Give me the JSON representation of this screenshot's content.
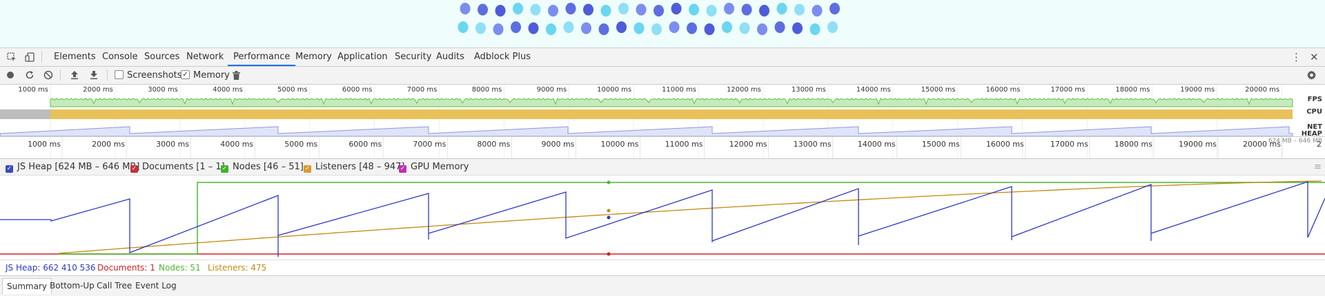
{
  "tabs": [
    "Elements",
    "Console",
    "Sources",
    "Network",
    "Performance",
    "Memory",
    "Application",
    "Security",
    "Audits",
    "Adblock Plus"
  ],
  "active_tab": "Performance",
  "toolbar": {
    "screenshots_label": "Screenshots",
    "screenshots_checked": false,
    "memory_label": "Memory",
    "memory_checked": true
  },
  "overview": {
    "ticks": [
      "1000 ms",
      "2000 ms",
      "3000 ms",
      "4000 ms",
      "5000 ms",
      "6000 ms",
      "7000 ms",
      "8000 ms",
      "9000 ms",
      "10000 ms",
      "11000 ms",
      "12000 ms",
      "13000 ms",
      "14000 ms",
      "15000 ms",
      "16000 ms",
      "17000 ms",
      "18000 ms",
      "19000 ms",
      "20000 ms"
    ],
    "fps_label": "FPS",
    "cpu_label": "CPU",
    "net_label": "NET",
    "heap_label": "HEAP",
    "heap_range": "624 MB – 646 MB"
  },
  "ruler": {
    "ticks": [
      "1000 ms",
      "2000 ms",
      "3000 ms",
      "4000 ms",
      "5000 ms",
      "6000 ms",
      "7000 ms",
      "8000 ms",
      "9000 ms",
      "10000 ms",
      "11000 ms",
      "12000 ms",
      "13000 ms",
      "14000 ms",
      "15000 ms",
      "16000 ms",
      "17000 ms",
      "18000 ms",
      "19000 ms",
      "20000 ms"
    ],
    "overflow": "2"
  },
  "legend": [
    {
      "label": "JS Heap [624 MB – 646 MB]",
      "color": "#3b4bbf",
      "checked": true
    },
    {
      "label": "Documents [1 – 1]",
      "color": "#c5323b",
      "checked": true
    },
    {
      "label": "Nodes [46 – 51]",
      "color": "#3eb22a",
      "checked": true
    },
    {
      "label": "Listeners [48 – 947]",
      "color": "#d99a2b",
      "checked": true
    },
    {
      "label": "GPU Memory",
      "color": "#c02fb3",
      "checked": true
    }
  ],
  "counters": {
    "js_heap": "JS Heap: 662 410 536",
    "documents": "Documents: 1",
    "nodes": "Nodes: 51",
    "listeners": "Listeners: 475"
  },
  "colors": {
    "js_heap": "#2b38c4",
    "documents": "#d02020",
    "nodes": "#4ab82f",
    "listeners": "#c08a10",
    "fps": "#5bbf49",
    "cpu": "#e8c15a"
  },
  "bottom_tabs": [
    "Summary",
    "Bottom-Up",
    "Call Tree",
    "Event Log"
  ],
  "active_bottom_tab": "Summary"
}
